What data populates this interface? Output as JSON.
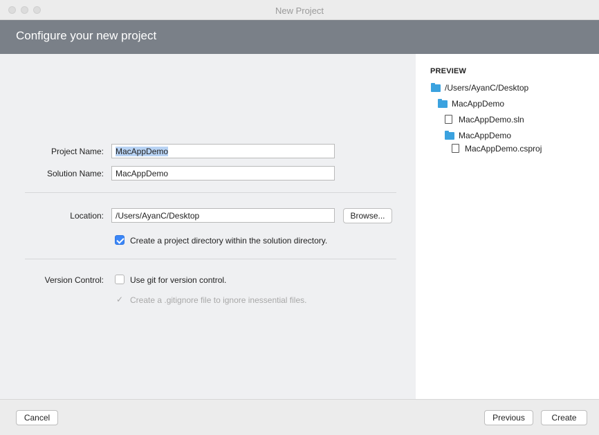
{
  "window": {
    "title": "New Project"
  },
  "header": {
    "title": "Configure your new project"
  },
  "form": {
    "project_name_label": "Project Name:",
    "project_name_value": "MacAppDemo",
    "solution_name_label": "Solution Name:",
    "solution_name_value": "MacAppDemo",
    "location_label": "Location:",
    "location_value": "/Users/AyanC/Desktop",
    "browse_label": "Browse...",
    "create_dir_label": "Create a project directory within the solution directory.",
    "create_dir_checked": true,
    "version_control_label": "Version Control:",
    "use_git_label": "Use git for version control.",
    "use_git_checked": false,
    "gitignore_label": "Create a .gitignore file to ignore inessential files.",
    "gitignore_checked": true,
    "gitignore_enabled": false
  },
  "preview": {
    "title": "PREVIEW",
    "tree": [
      {
        "type": "folder",
        "name": "/Users/AyanC/Desktop"
      },
      {
        "type": "folder",
        "name": "MacAppDemo"
      },
      {
        "type": "file",
        "name": "MacAppDemo.sln"
      },
      {
        "type": "folder",
        "name": "MacAppDemo"
      },
      {
        "type": "file",
        "name": "MacAppDemo.csproj"
      }
    ]
  },
  "footer": {
    "cancel_label": "Cancel",
    "previous_label": "Previous",
    "create_label": "Create"
  },
  "colors": {
    "header_bg": "#7a8088",
    "accent": "#3b86f7",
    "folder": "#3ba2df",
    "selection": "#b8d3f4"
  }
}
